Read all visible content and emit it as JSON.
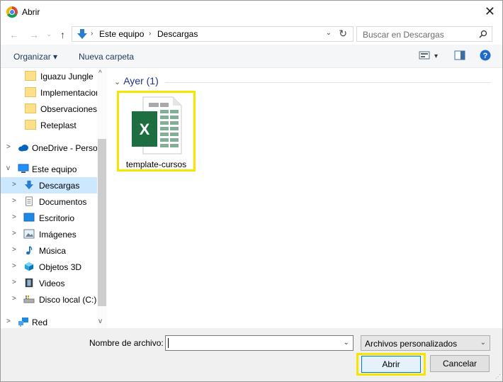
{
  "window": {
    "title": "Abrir",
    "close_glyph": "✕"
  },
  "nav": {
    "back": "←",
    "forward": "→",
    "recent": "⌄",
    "up": "↑"
  },
  "address": {
    "path": [
      "Este equipo",
      "Descargas"
    ],
    "separator": "›",
    "dropdown": "⌄",
    "refresh": "↻"
  },
  "search": {
    "placeholder": "Buscar en Descargas"
  },
  "toolbar": {
    "organize": "Organizar ▾",
    "new_folder": "Nueva carpeta",
    "view_drop": "▾"
  },
  "sidebar": {
    "items": [
      {
        "label": "Iguazu Jungle",
        "icon": "folder-icon",
        "chevron": "",
        "selected": false
      },
      {
        "label": "Implementacion",
        "icon": "folder-icon",
        "chevron": "",
        "selected": false
      },
      {
        "label": "Observaciones",
        "icon": "folder-icon",
        "chevron": "",
        "selected": false
      },
      {
        "label": "Reteplast",
        "icon": "folder-icon",
        "chevron": "",
        "selected": false
      },
      {
        "label": "OneDrive - Persor",
        "icon": "cloud-icon",
        "chevron": ">",
        "selected": false
      },
      {
        "label": "Este equipo",
        "icon": "computer-icon",
        "chevron": "v",
        "selected": false
      },
      {
        "label": "Descargas",
        "icon": "download-icon",
        "chevron": ">",
        "selected": true
      },
      {
        "label": "Documentos",
        "icon": "document-icon",
        "chevron": ">",
        "selected": false
      },
      {
        "label": "Escritorio",
        "icon": "desktop-icon",
        "chevron": ">",
        "selected": false
      },
      {
        "label": "Imágenes",
        "icon": "images-icon",
        "chevron": ">",
        "selected": false
      },
      {
        "label": "Música",
        "icon": "music-icon",
        "chevron": ">",
        "selected": false
      },
      {
        "label": "Objetos 3D",
        "icon": "cube-icon",
        "chevron": ">",
        "selected": false
      },
      {
        "label": "Videos",
        "icon": "video-icon",
        "chevron": ">",
        "selected": false
      },
      {
        "label": "Disco local (C:)",
        "icon": "drive-icon",
        "chevron": ">",
        "selected": false
      },
      {
        "label": "Red",
        "icon": "network-icon",
        "chevron": ">",
        "selected": false
      }
    ],
    "scroll_up": "^",
    "scroll_down": "v"
  },
  "content": {
    "group_header": "Ayer (1)",
    "group_chevron": "⌄",
    "files": [
      {
        "name": "template-cursos",
        "icon": "excel-file-icon",
        "badge": "X"
      }
    ]
  },
  "footer": {
    "filename_label": "Nombre de archivo:",
    "filename_value": "",
    "filename_drop": "⌄",
    "filetype": "Archivos personalizados",
    "filetype_drop": "⌄",
    "open_button": "Abrir",
    "cancel_button": "Cancelar",
    "grip": "⋰"
  },
  "colors": {
    "accent": "#0078d7",
    "highlight": "#f5e600",
    "selection": "#cce8ff",
    "excel_green": "#1d6f42"
  }
}
